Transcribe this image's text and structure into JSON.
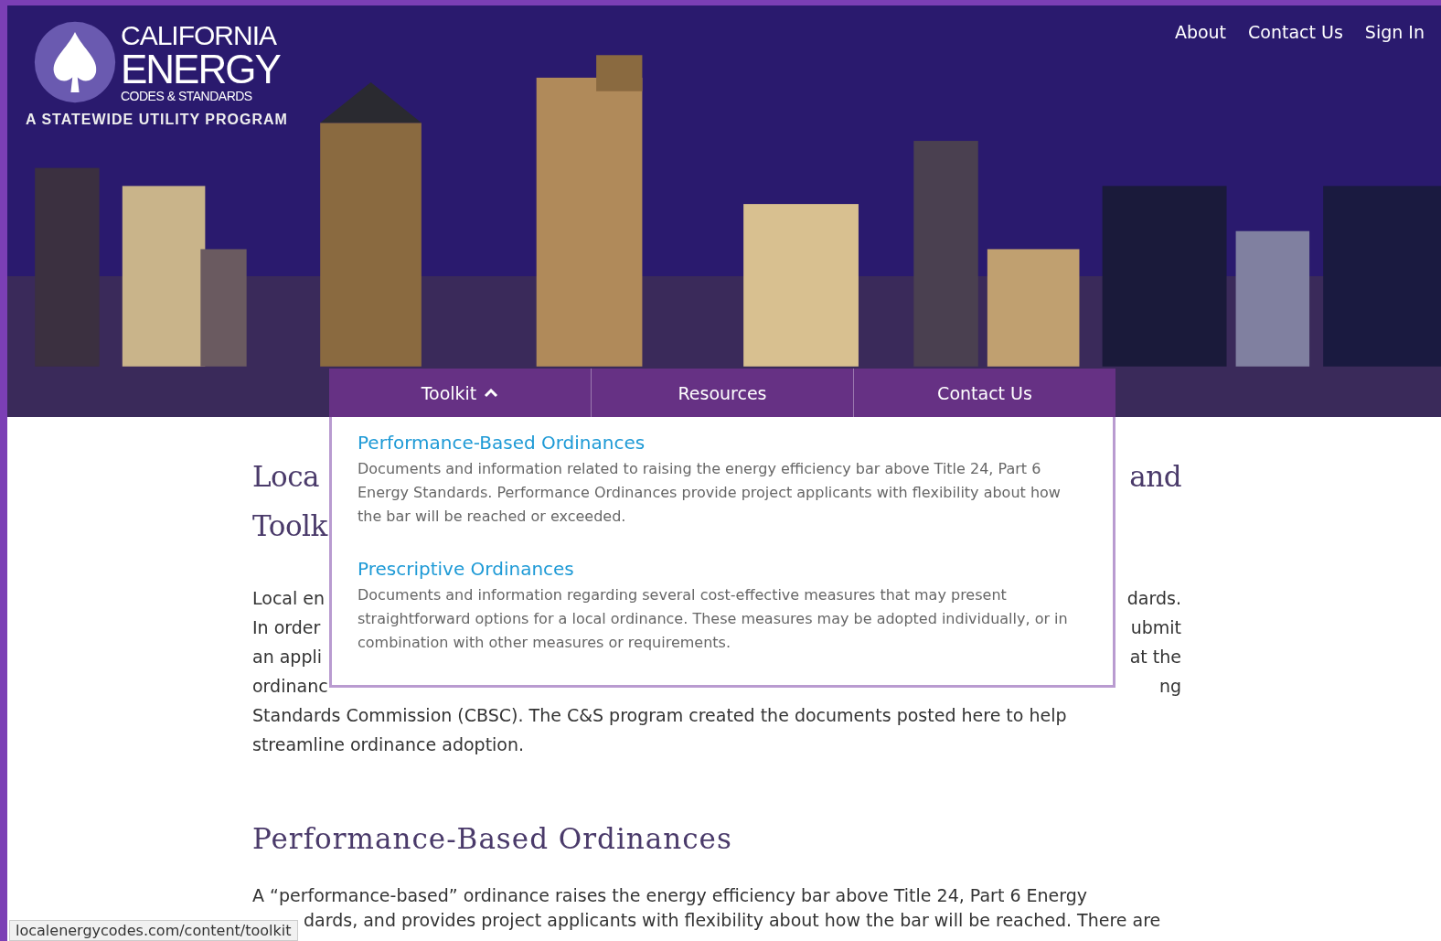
{
  "logo": {
    "lines": [
      "CALIFORNIA",
      "ENERGY",
      "CODES & STANDARDS"
    ],
    "tagline": "A STATEWIDE UTILITY PROGRAM"
  },
  "top_links": [
    "About",
    "Contact Us",
    "Sign In"
  ],
  "nav": [
    {
      "label": "Toolkit",
      "expanded": true
    },
    {
      "label": "Resources"
    },
    {
      "label": "Contact Us"
    }
  ],
  "dropdown": [
    {
      "title": "Performance-Based Ordinances",
      "description": "Documents and information related to raising the energy efficiency bar above Title 24, Part 6 Energy Standards. Performance Ordinances provide project applicants with flexibility about how the bar will be reached or exceeded."
    },
    {
      "title": "Prescriptive Ordinances",
      "description": "Documents and information regarding several cost-effective measures that may present straightforward options for a local ordinance. These measures may be adopted individually, or in combination with other measures or requirements."
    }
  ],
  "heading_fragments": [
    {
      "left": "Loca",
      "right": "and"
    },
    {
      "left": "Toolk"
    }
  ],
  "intro_lines": [
    {
      "left": "Local en",
      "right": "dards."
    },
    {
      "left": "In order",
      "right": "ubmit"
    },
    {
      "left": "an appli",
      "right": "at the"
    },
    {
      "left": "ordinanc",
      "right": "ng"
    },
    {
      "left": "Standards Commission (CBSC). The C&S program created the documents posted here to help"
    },
    {
      "left": "streamline ordinance adoption."
    }
  ],
  "section_heading": "Performance-Based Ordinances",
  "section_lines": [
    "A “performance-based” ordinance raises the energy efficiency bar above Title 24, Part 6 Energy",
    "dards, and provides project applicants with flexibility about how the bar will be reached. There are"
  ],
  "status_url": "localenergycodes.com/content/toolkit"
}
